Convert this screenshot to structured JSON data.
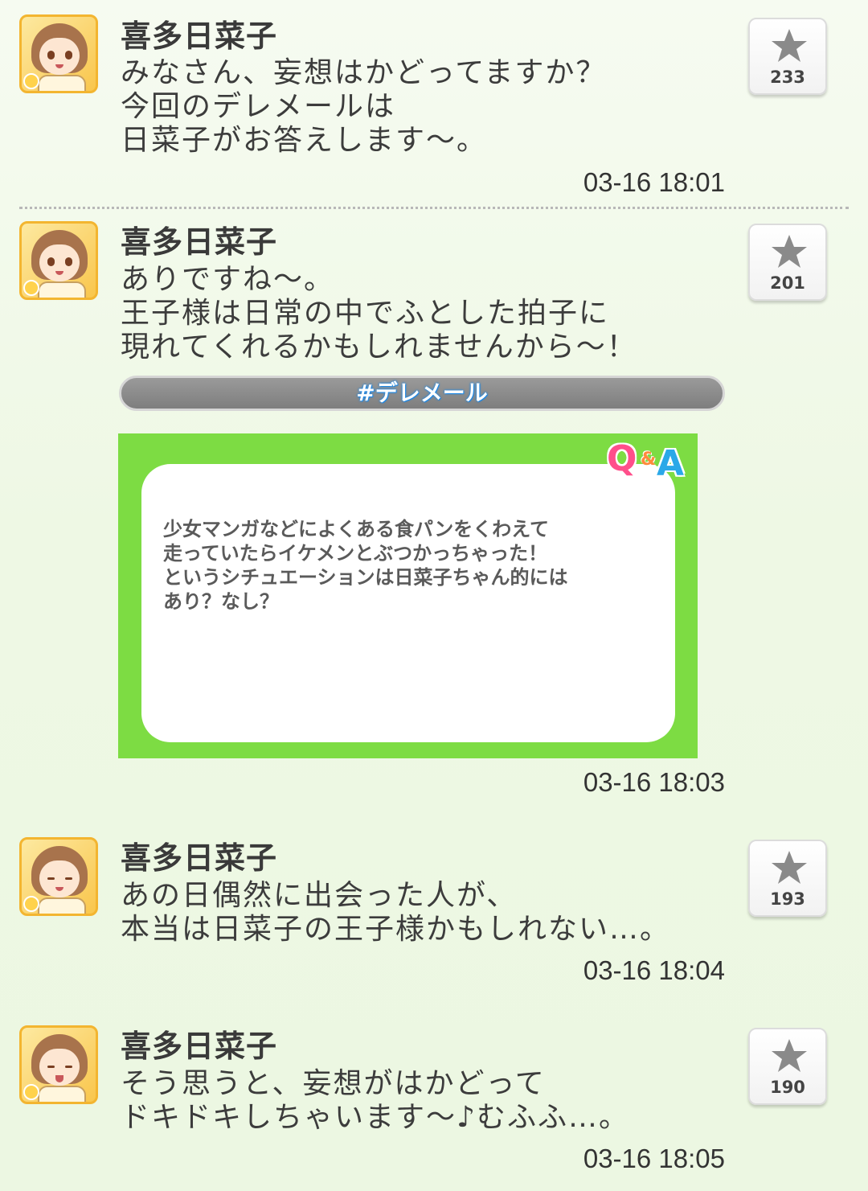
{
  "posts": [
    {
      "author": "喜多日菜子",
      "message": "みなさん、妄想はかどってますか？\n今回のデレメールは\n日菜子がお答えします〜。",
      "timestamp": "03-16 18:01",
      "likes": "233",
      "avatar_expression": "smile"
    },
    {
      "author": "喜多日菜子",
      "message": "ありですね〜。\n王子様は日常の中でふとした拍子に\n現れてくれるかもしれませんから〜！",
      "hashtag": "#デレメール",
      "qa_card": {
        "badge_q": "Q",
        "badge_amp": "&",
        "badge_a": "A",
        "question": "少女マンガなどによくある食パンをくわえて\n走っていたらイケメンとぶつかっちゃった！\nというシチュエーションは日菜子ちゃん的には\nあり？なし？",
        "frame_color": "#7ddc43"
      },
      "timestamp": "03-16 18:03",
      "likes": "201",
      "avatar_expression": "smile"
    },
    {
      "author": "喜多日菜子",
      "message": "あの日偶然に出会った人が、\n本当は日菜子の王子様かもしれない…。",
      "timestamp": "03-16 18:04",
      "likes": "193",
      "avatar_expression": "eyes-closed"
    },
    {
      "author": "喜多日菜子",
      "message": "そう思うと、妄想がはかどって\nドキドキしちゃいます〜♪むふふ…。",
      "timestamp": "03-16 18:05",
      "likes": "190",
      "avatar_expression": "eyes-closed-happy"
    }
  ],
  "icons": {
    "like": "star-icon",
    "avatar": "character-avatar-icon"
  },
  "colors": {
    "background": "#eef8e4",
    "hashtag_text": "#ffffff",
    "hashtag_glow": "#1e88e5",
    "avatar_frame": "#f3b530"
  }
}
